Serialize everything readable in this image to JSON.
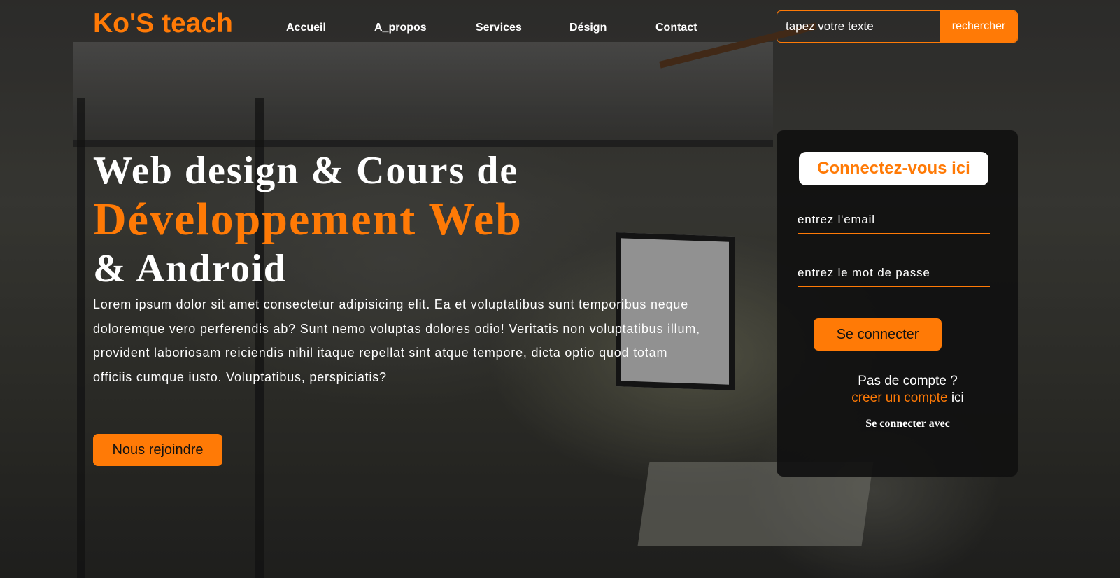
{
  "header": {
    "logo": "Ko'S teach",
    "nav": [
      "Accueil",
      "A_propos",
      "Services",
      "Désign",
      "Contact"
    ],
    "search": {
      "placeholder": "tapez votre texte",
      "button": "rechercher"
    }
  },
  "hero": {
    "title_line1": "Web design & Cours de",
    "title_line2": "Développement Web",
    "title_line3": "& Android",
    "text": "Lorem ipsum dolor sit amet consectetur adipisicing elit. Ea et voluptatibus sunt temporibus neque doloremque vero perferendis ab? Sunt nemo voluptas dolores odio! Veritatis non voluptatibus illum, provident laboriosam reiciendis nihil itaque repellat sint atque tempore, dicta optio quod totam officiis cumque iusto. Voluptatibus, perspiciatis?",
    "join_button": "Nous rejoindre"
  },
  "login": {
    "title": "Connectez-vous ici",
    "email_placeholder": "entrez l'email",
    "password_placeholder": "entrez le mot de passe",
    "submit": "Se connecter",
    "no_account": "Pas de compte ?",
    "create_link": "creer un compte",
    "here": "ici",
    "social": "Se connecter avec"
  },
  "colors": {
    "accent": "#ff7a06",
    "panel": "#101010"
  }
}
